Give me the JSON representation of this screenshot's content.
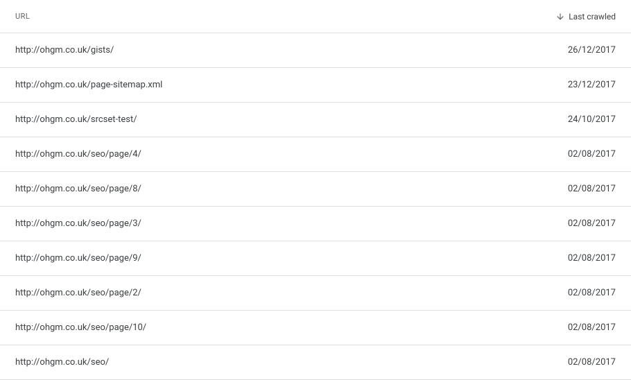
{
  "table": {
    "headers": {
      "url": "URL",
      "date": "Last crawled"
    },
    "rows": [
      {
        "url": "http://ohgm.co.uk/gists/",
        "date": "26/12/2017"
      },
      {
        "url": "http://ohgm.co.uk/page-sitemap.xml",
        "date": "23/12/2017"
      },
      {
        "url": "http://ohgm.co.uk/srcset-test/",
        "date": "24/10/2017"
      },
      {
        "url": "http://ohgm.co.uk/seo/page/4/",
        "date": "02/08/2017"
      },
      {
        "url": "http://ohgm.co.uk/seo/page/8/",
        "date": "02/08/2017"
      },
      {
        "url": "http://ohgm.co.uk/seo/page/3/",
        "date": "02/08/2017"
      },
      {
        "url": "http://ohgm.co.uk/seo/page/9/",
        "date": "02/08/2017"
      },
      {
        "url": "http://ohgm.co.uk/seo/page/2/",
        "date": "02/08/2017"
      },
      {
        "url": "http://ohgm.co.uk/seo/page/10/",
        "date": "02/08/2017"
      },
      {
        "url": "http://ohgm.co.uk/seo/",
        "date": "02/08/2017"
      }
    ]
  }
}
